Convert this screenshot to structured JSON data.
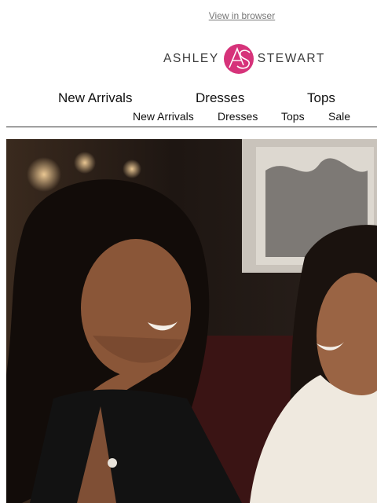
{
  "preheader": {
    "view_in_browser": "View in browser"
  },
  "brand": {
    "left": "ASHLEY",
    "right": "STEWART",
    "monogram": "AS",
    "accent": "#d6337a"
  },
  "nav_primary": [
    "New Arrivals",
    "Dresses",
    "Tops"
  ],
  "nav_secondary": [
    "New Arrivals",
    "Dresses",
    "Tops",
    "Sale"
  ],
  "hero": {
    "image": "two-women-smiling-photo"
  }
}
